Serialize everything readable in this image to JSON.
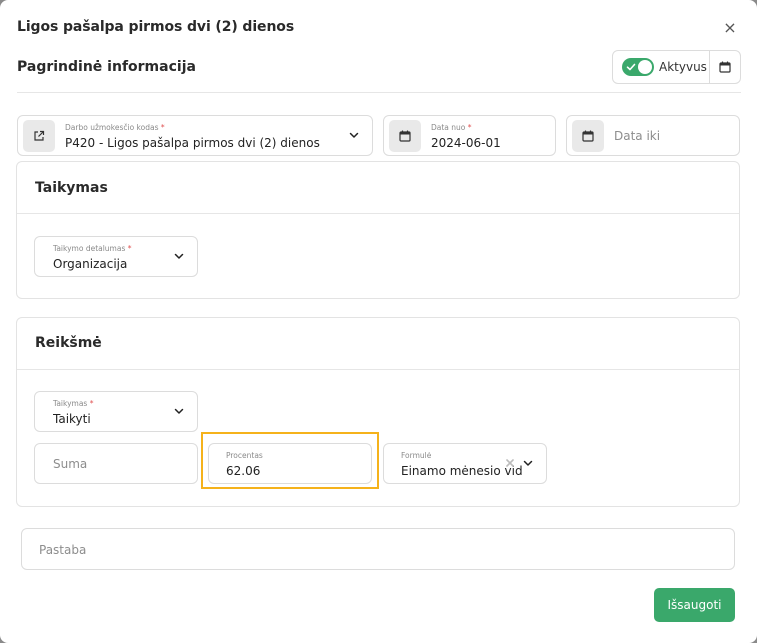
{
  "modal": {
    "title": "Ligos pašalpa pirmos dvi (2) dienos",
    "close_glyph": "×"
  },
  "header": {
    "section_title": "Pagrindinė informacija",
    "active_toggle": {
      "label": "Aktyvus",
      "on": true
    }
  },
  "fields": {
    "pay_code": {
      "label": "Darbo užmokesčio kodas",
      "value": "P420 - Ligos pašalpa pirmos dvi (2) dienos",
      "required_mark": "*"
    },
    "date_from": {
      "label": "Data nuo",
      "value": "2024-06-01",
      "required_mark": "*"
    },
    "date_to": {
      "placeholder": "Data iki"
    }
  },
  "taikymas_card": {
    "title": "Taikymas",
    "detail_field": {
      "label": "Taikymo detalumas",
      "value": "Organizacija",
      "required_mark": "*"
    }
  },
  "reiksme_card": {
    "title": "Reikšmė",
    "apply_field": {
      "label": "Taikymas",
      "value": "Taikyti",
      "required_mark": "*"
    },
    "suma": {
      "placeholder": "Suma"
    },
    "procentas": {
      "label": "Procentas",
      "value": "62.06"
    },
    "formule": {
      "label": "Formulė",
      "value": "Einamo mėnesio vidur"
    }
  },
  "pastaba": {
    "placeholder": "Pastaba"
  },
  "actions": {
    "save_label": "Išsaugoti"
  },
  "colors": {
    "accent": "#3aa86b",
    "highlight": "#f5b21b",
    "required": "#e05050"
  },
  "icons": [
    "close-icon",
    "calendar-icon",
    "external-link-icon",
    "chevron-down-icon",
    "clear-icon",
    "check-icon"
  ]
}
